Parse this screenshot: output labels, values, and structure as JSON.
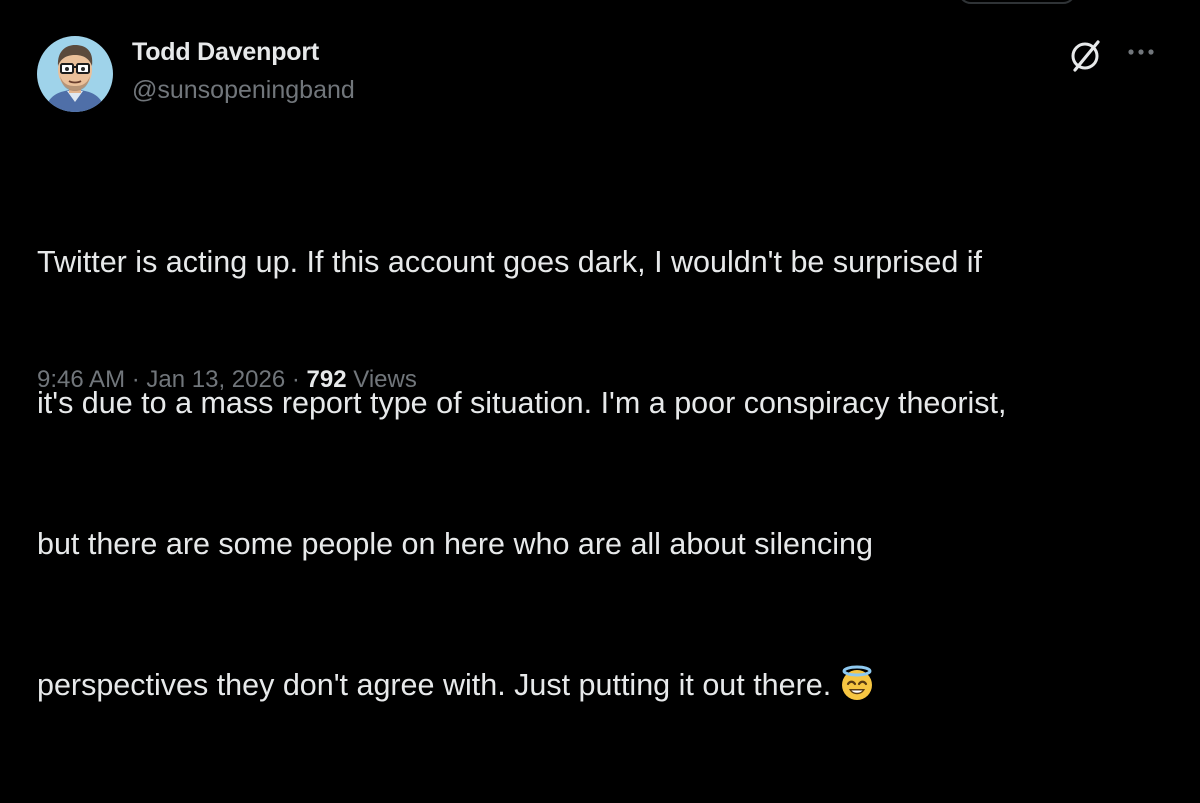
{
  "author": {
    "display_name": "Todd Davenport",
    "handle": "@sunsopeningband",
    "avatar_icon": "cartoon-man-with-glasses-avatar"
  },
  "header_actions": {
    "grok_icon": "grok-slash-circle-icon",
    "more_icon": "more-options-icon"
  },
  "tweet": {
    "lines": [
      "Twitter is acting up. If this account goes dark, I wouldn't be surprised if",
      "it's due to a mass report type of situation. I'm a poor conspiracy theorist,",
      "but there are some people on here who are all about silencing",
      "perspectives they don't agree with. Just putting it out there."
    ],
    "emoji": "smiling-face-with-halo"
  },
  "meta": {
    "time": "9:46 AM",
    "separator": "·",
    "date": "Jan 13, 2026",
    "views_count": "792",
    "views_label": "Views"
  },
  "colors": {
    "background": "#000000",
    "primary_text": "#e7e9ea",
    "secondary_text": "#71767b"
  }
}
